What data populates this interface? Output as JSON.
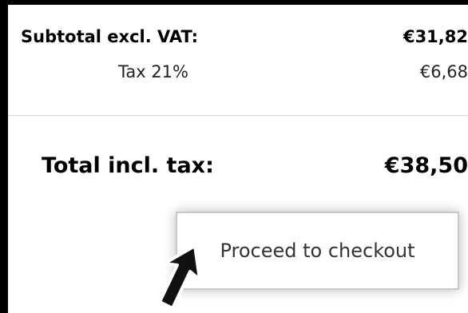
{
  "summary": {
    "subtotal_label": "Subtotal excl. VAT:",
    "subtotal_value": "€31,82",
    "tax_label": "Tax 21%",
    "tax_value": "€6,68",
    "total_label": "Total incl. tax:",
    "total_value": "€38,50"
  },
  "actions": {
    "checkout_label": "Proceed to checkout"
  },
  "cursor": {
    "icon": "arrow-cursor-icon"
  },
  "colors": {
    "background": "#000000",
    "card": "#ffffff",
    "divider": "#d8d8d8"
  }
}
